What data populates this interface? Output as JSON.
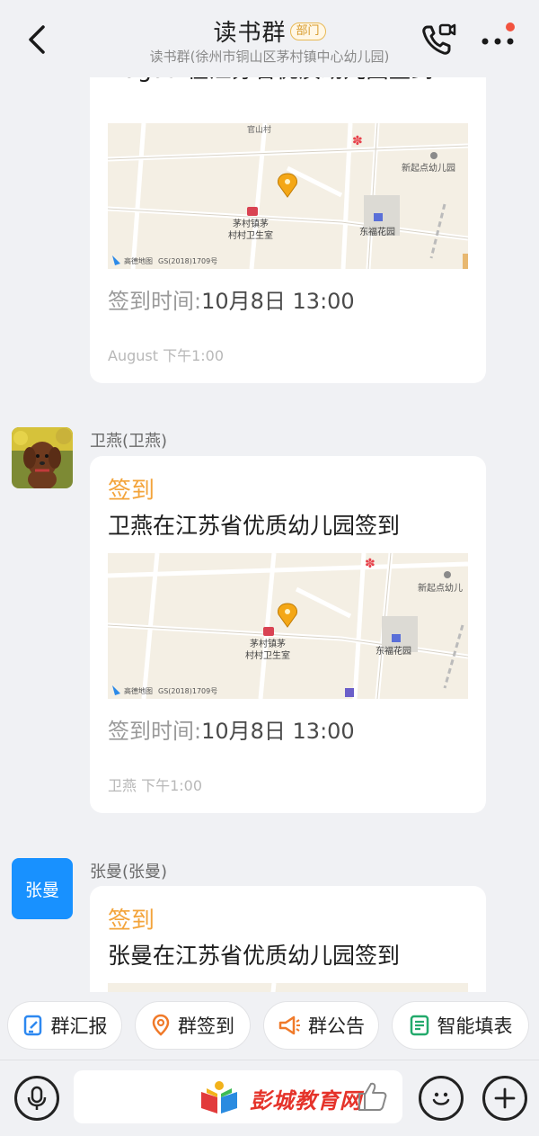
{
  "header": {
    "title": "读书群",
    "badge": "部门",
    "subtitle": "读书群(徐州市铜山区茅村镇中心幼儿园)"
  },
  "map_labels": {
    "village": "官山村",
    "kindergarten": "新起点幼儿园",
    "clinic_line1": "茅村镇茅",
    "clinic_line2": "村村卫生室",
    "garden": "东福花园",
    "copyright": "GS(2018)1709号",
    "provider": "高德地图",
    "kindergarten_clipped": "新起点幼儿"
  },
  "messages": [
    {
      "text": "August在江苏省优质幼儿园签到",
      "time_label": "签到时间:",
      "time_value": "10月8日 13:00",
      "meta": "August 下午1:00"
    },
    {
      "sender": "卫燕(卫燕)",
      "title": "签到",
      "text": "卫燕在江苏省优质幼儿园签到",
      "time_label": "签到时间:",
      "time_value": "10月8日 13:00",
      "meta": "卫燕 下午1:00"
    },
    {
      "sender": "张曼(张曼)",
      "avatar_text": "张曼",
      "title": "签到",
      "text": "张曼在江苏省优质幼儿园签到"
    }
  ],
  "quick_actions": [
    {
      "label": "群汇报",
      "icon": "report-icon"
    },
    {
      "label": "群签到",
      "icon": "location-pin-icon"
    },
    {
      "label": "群公告",
      "icon": "megaphone-icon"
    },
    {
      "label": "智能填表",
      "icon": "form-icon"
    }
  ],
  "input": {
    "watermark": "彭城教育网"
  },
  "colors": {
    "accent_orange": "#f3a43b",
    "avatar_blue": "#1891ff",
    "badge_gold": "#d79a29",
    "notification_red": "#f2533f"
  }
}
